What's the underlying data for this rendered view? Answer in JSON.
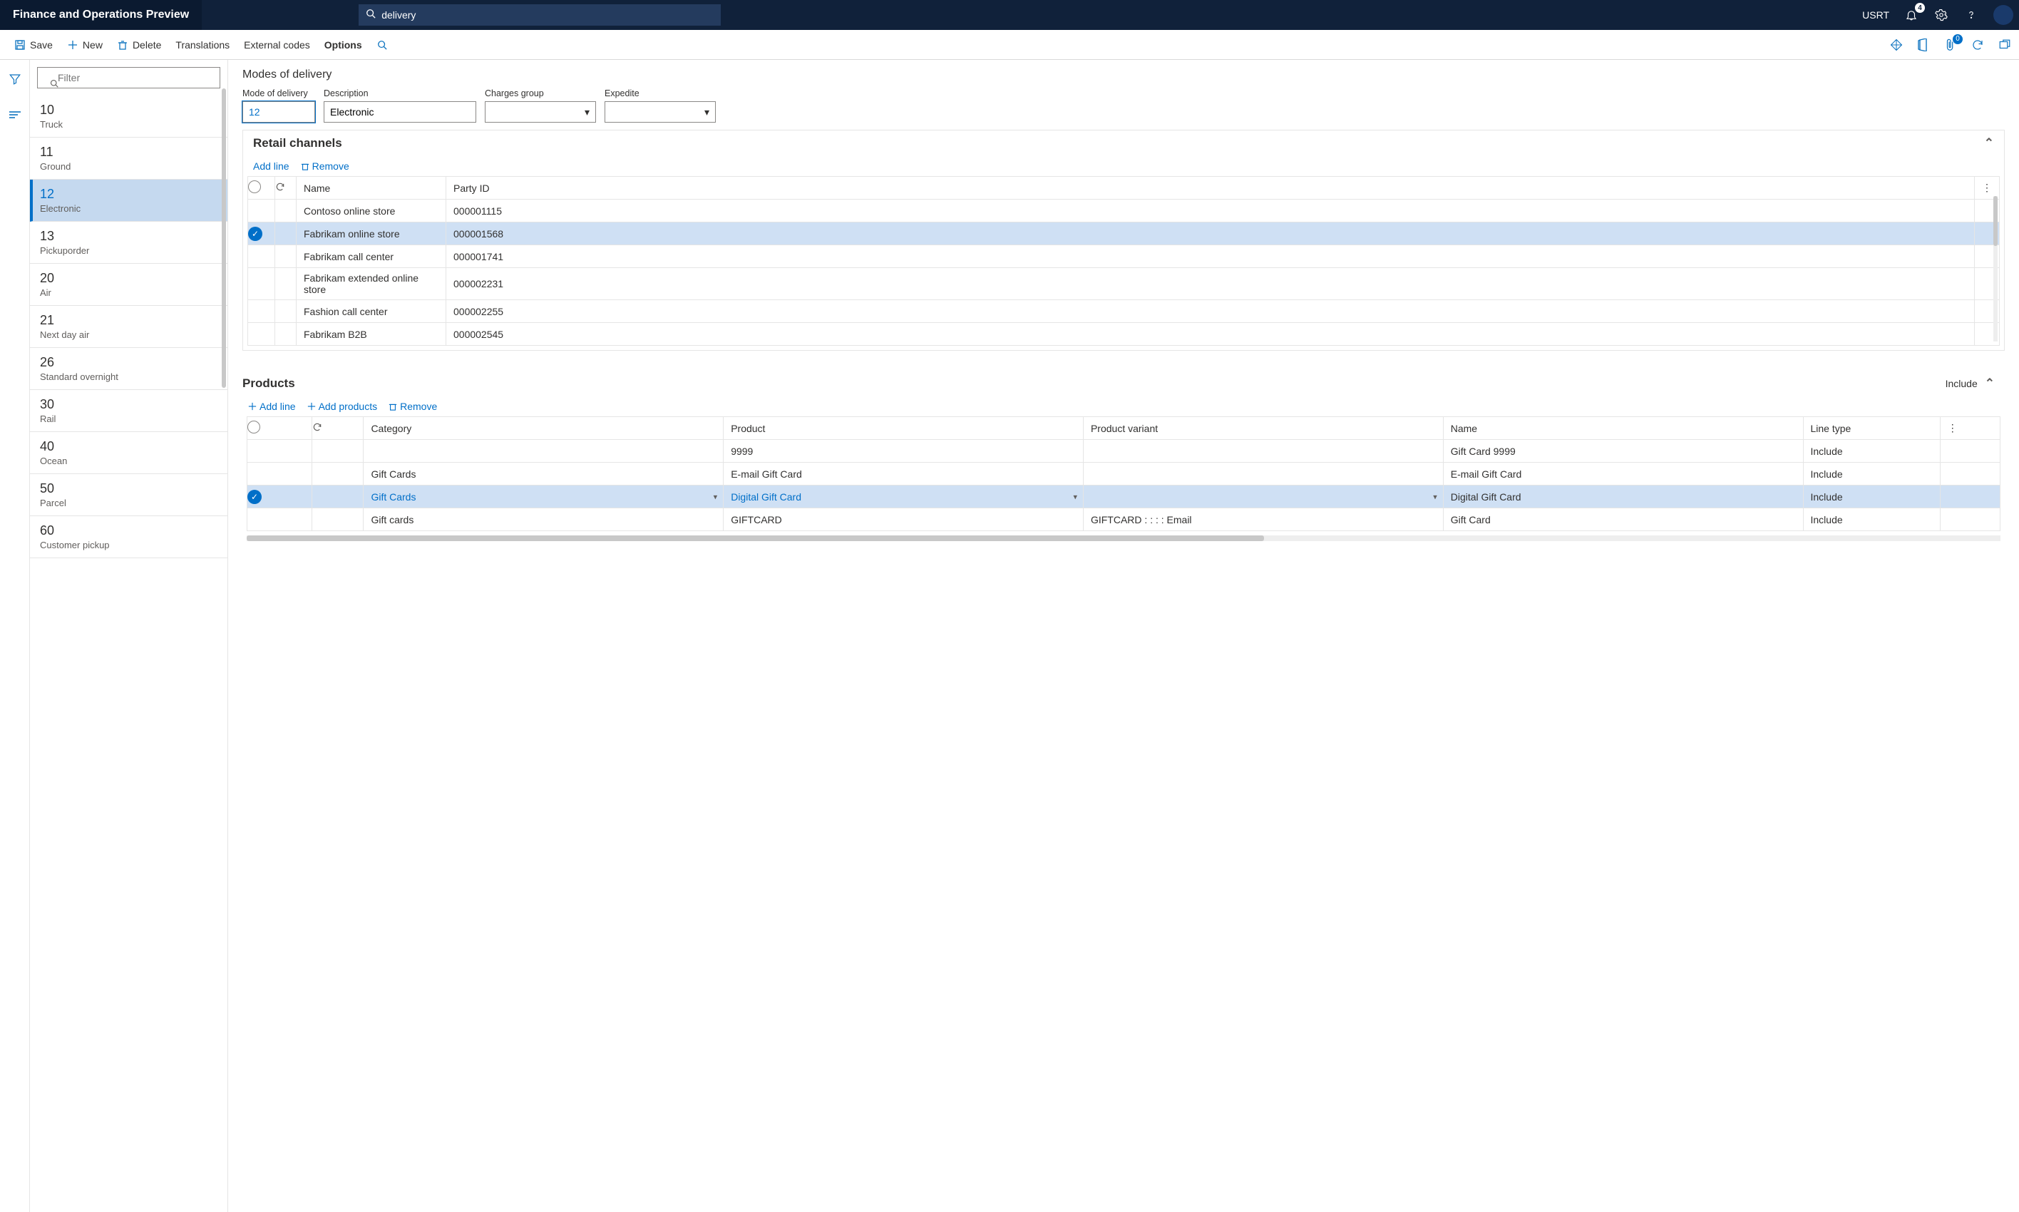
{
  "app": {
    "title": "Finance and Operations Preview"
  },
  "search": {
    "value": "delivery"
  },
  "user": {
    "label": "USRT",
    "notification_count": "4",
    "attachment_count": "0"
  },
  "cmdbar": {
    "save": "Save",
    "new": "New",
    "delete": "Delete",
    "translations": "Translations",
    "external": "External codes",
    "options": "Options"
  },
  "filter": {
    "placeholder": "Filter"
  },
  "modes": [
    {
      "code": "10",
      "desc": "Truck"
    },
    {
      "code": "11",
      "desc": "Ground"
    },
    {
      "code": "12",
      "desc": "Electronic"
    },
    {
      "code": "13",
      "desc": "Pickuporder"
    },
    {
      "code": "20",
      "desc": "Air"
    },
    {
      "code": "21",
      "desc": "Next day air"
    },
    {
      "code": "26",
      "desc": "Standard overnight"
    },
    {
      "code": "30",
      "desc": "Rail"
    },
    {
      "code": "40",
      "desc": "Ocean"
    },
    {
      "code": "50",
      "desc": "Parcel"
    },
    {
      "code": "60",
      "desc": "Customer pickup"
    }
  ],
  "page": {
    "title": "Modes of delivery"
  },
  "form": {
    "mode_label": "Mode of delivery",
    "mode_value": "12",
    "desc_label": "Description",
    "desc_value": "Electronic",
    "charges_label": "Charges group",
    "charges_value": "",
    "expedite_label": "Expedite",
    "expedite_value": ""
  },
  "retail": {
    "title": "Retail channels",
    "add": "Add line",
    "remove": "Remove",
    "cols": {
      "name": "Name",
      "party": "Party ID"
    },
    "rows": [
      {
        "name": "Contoso online store",
        "party": "000001115"
      },
      {
        "name": "Fabrikam online store",
        "party": "000001568"
      },
      {
        "name": "Fabrikam call center",
        "party": "000001741"
      },
      {
        "name": "Fabrikam extended online store",
        "party": "000002231"
      },
      {
        "name": "Fashion call center",
        "party": "000002255"
      },
      {
        "name": "Fabrikam B2B",
        "party": "000002545"
      }
    ],
    "selected_index": 1
  },
  "products": {
    "title": "Products",
    "hint": "Include",
    "addline": "Add line",
    "addprod": "Add products",
    "remove": "Remove",
    "cols": {
      "category": "Category",
      "product": "Product",
      "variant": "Product variant",
      "name": "Name",
      "linetype": "Line type"
    },
    "rows": [
      {
        "category": "",
        "product": "9999",
        "variant": "",
        "name": "Gift Card 9999",
        "linetype": "Include"
      },
      {
        "category": "Gift Cards",
        "product": "E-mail Gift Card",
        "variant": "",
        "name": "E-mail Gift Card",
        "linetype": "Include"
      },
      {
        "category": "Gift Cards",
        "product": "Digital Gift Card",
        "variant": "",
        "name": "Digital Gift Card",
        "linetype": "Include"
      },
      {
        "category": "Gift cards",
        "product": "GIFTCARD",
        "variant": "GIFTCARD :  :  :  : Email",
        "name": "Gift Card",
        "linetype": "Include"
      }
    ],
    "selected_index": 2
  }
}
